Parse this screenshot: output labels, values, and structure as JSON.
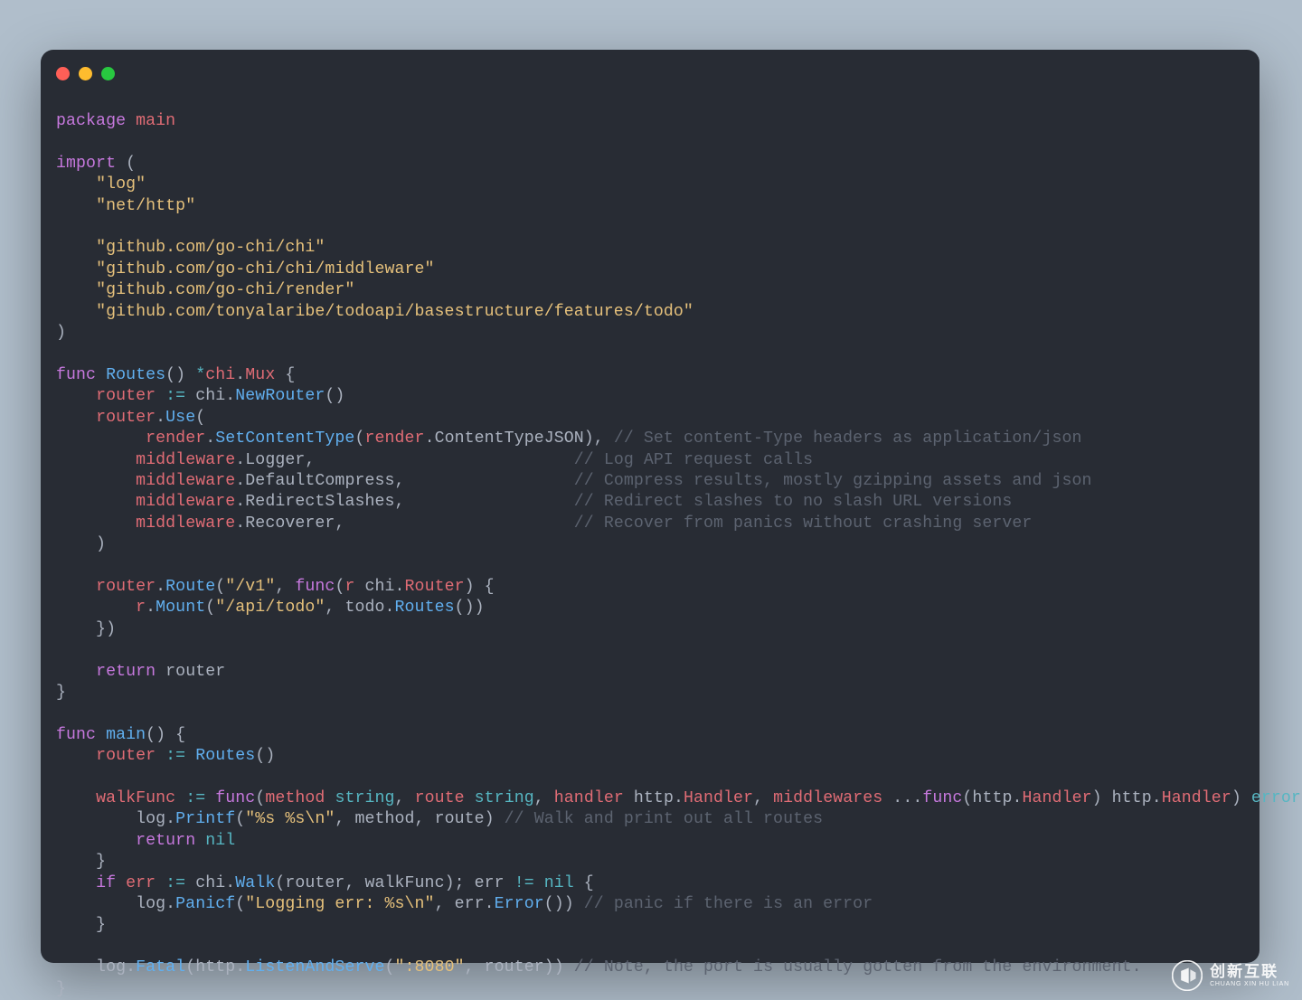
{
  "window": {
    "dots": [
      "red",
      "yellow",
      "green"
    ]
  },
  "code": {
    "l01a": "package",
    "l01b": " main",
    "l02": "",
    "l03a": "import",
    "l03b": " (",
    "l04a": "    ",
    "l04b": "\"log\"",
    "l05a": "    ",
    "l05b": "\"net/http\"",
    "l06": "",
    "l07a": "    ",
    "l07b": "\"github.com/go-chi/chi\"",
    "l08a": "    ",
    "l08b": "\"github.com/go-chi/chi/middleware\"",
    "l09a": "    ",
    "l09b": "\"github.com/go-chi/render\"",
    "l10a": "    ",
    "l10b": "\"github.com/tonyalaribe/todoapi/basestructure/features/todo\"",
    "l11": ")",
    "l12": "",
    "l13a": "func",
    "l13b": " ",
    "l13c": "Routes",
    "l13d": "() ",
    "l13e": "*",
    "l13f": "chi",
    "l13g": ".",
    "l13h": "Mux",
    "l13i": " {",
    "l14a": "    ",
    "l14b": "router",
    "l14c": " ",
    "l14d": ":=",
    "l14e": " chi.",
    "l14f": "NewRouter",
    "l14g": "()",
    "l15a": "    ",
    "l15b": "router",
    "l15c": ".",
    "l15d": "Use",
    "l15e": "(",
    "l16a": "         ",
    "l16b": "render",
    "l16c": ".",
    "l16d": "SetContentType",
    "l16e": "(",
    "l16f": "render",
    "l16g": ".ContentTypeJSON), ",
    "l16h": "// Set content-Type headers as application/json",
    "l17a": "        ",
    "l17b": "middleware",
    "l17c": ".Logger,                          ",
    "l17d": "// Log API request calls",
    "l18a": "        ",
    "l18b": "middleware",
    "l18c": ".DefaultCompress,                 ",
    "l18d": "// Compress results, mostly gzipping assets and json",
    "l19a": "        ",
    "l19b": "middleware",
    "l19c": ".RedirectSlashes,                 ",
    "l19d": "// Redirect slashes to no slash URL versions",
    "l20a": "        ",
    "l20b": "middleware",
    "l20c": ".Recoverer,                       ",
    "l20d": "// Recover from panics without crashing server",
    "l21": "    )",
    "l22": "",
    "l23a": "    ",
    "l23b": "router",
    "l23c": ".",
    "l23d": "Route",
    "l23e": "(",
    "l23f": "\"/v1\"",
    "l23g": ", ",
    "l23h": "func",
    "l23i": "(",
    "l23j": "r",
    "l23k": " chi.",
    "l23l": "Router",
    "l23m": ") {",
    "l24a": "        ",
    "l24b": "r",
    "l24c": ".",
    "l24d": "Mount",
    "l24e": "(",
    "l24f": "\"/api/todo\"",
    "l24g": ", todo.",
    "l24h": "Routes",
    "l24i": "())",
    "l25": "    })",
    "l26": "",
    "l27a": "    ",
    "l27b": "return",
    "l27c": " router",
    "l28": "}",
    "l29": "",
    "l30a": "func",
    "l30b": " ",
    "l30c": "main",
    "l30d": "() {",
    "l31a": "    ",
    "l31b": "router",
    "l31c": " ",
    "l31d": ":=",
    "l31e": " ",
    "l31f": "Routes",
    "l31g": "()",
    "l32": "",
    "l33a": "    ",
    "l33b": "walkFunc",
    "l33c": " ",
    "l33d": ":=",
    "l33e": " ",
    "l33f": "func",
    "l33g": "(",
    "l33h": "method",
    "l33i": " ",
    "l33j": "string",
    "l33k": ", ",
    "l33l": "route",
    "l33m": " ",
    "l33n": "string",
    "l33o": ", ",
    "l33p": "handler",
    "l33q": " http.",
    "l33r": "Handler",
    "l33s": ", ",
    "l33t": "middlewares",
    "l33u": " ...",
    "l33v": "func",
    "l33w": "(http.",
    "l33x": "Handler",
    "l33y": ") http.",
    "l33z": "Handler",
    "l33aa": ") ",
    "l33ab": "error",
    "l33ac": " {",
    "l34a": "        log.",
    "l34b": "Printf",
    "l34c": "(",
    "l34d": "\"%s %s\\n\"",
    "l34e": ", method, route) ",
    "l34f": "// Walk and print out all routes",
    "l35a": "        ",
    "l35b": "return",
    "l35c": " ",
    "l35d": "nil",
    "l36": "    }",
    "l37a": "    ",
    "l37b": "if",
    "l37c": " ",
    "l37d": "err",
    "l37e": " ",
    "l37f": ":=",
    "l37g": " chi.",
    "l37h": "Walk",
    "l37i": "(router, walkFunc); err ",
    "l37j": "!=",
    "l37k": " ",
    "l37l": "nil",
    "l37m": " {",
    "l38a": "        log.",
    "l38b": "Panicf",
    "l38c": "(",
    "l38d": "\"Logging err: %s\\n\"",
    "l38e": ", err.",
    "l38f": "Error",
    "l38g": "()) ",
    "l38h": "// panic if there is an error",
    "l39": "    }",
    "l40": "",
    "l41a": "    log.",
    "l41b": "Fatal",
    "l41c": "(http.",
    "l41d": "ListenAndServe",
    "l41e": "(",
    "l41f": "\":8080\"",
    "l41g": ", router)) ",
    "l41h": "// Note, the port is usually gotten from the environment.",
    "l42": "}"
  },
  "watermark": {
    "main": "创新互联",
    "sub": "CHUANG XIN HU LIAN"
  }
}
